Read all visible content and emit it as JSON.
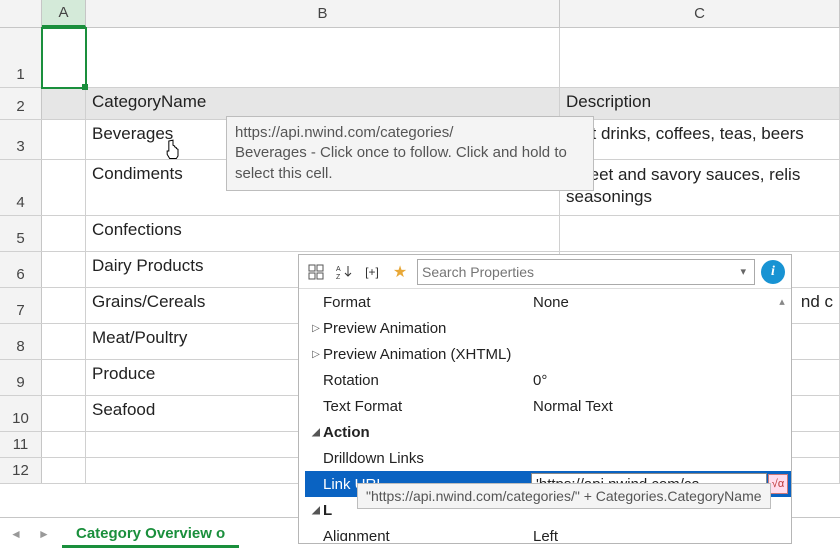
{
  "columns": {
    "A": "A",
    "B": "B",
    "C": "C"
  },
  "row_numbers": [
    "1",
    "2",
    "3",
    "4",
    "5",
    "6",
    "7",
    "8",
    "9",
    "10",
    "11",
    "12"
  ],
  "header": {
    "B": "CategoryName",
    "C": "Description"
  },
  "cells": {
    "B3": "Beverages",
    "C3": "Soft drinks, coffees, teas, beers",
    "B4": "Condiments",
    "C4": "Sweet and savory sauces, relis​ seasonings",
    "B5": "Confections",
    "C5": "",
    "B6": "Dairy Products",
    "B7": "Grains/Cereals",
    "C7": "nd c",
    "B8": "Meat/Poultry",
    "B9": "Produce",
    "B10": "Seafood"
  },
  "tooltip": {
    "url": "https://api.nwind.com/categories/",
    "rest": "Beverages - Click once to follow. Click and hold to select this cell."
  },
  "props": {
    "search_placeholder": "Search Properties",
    "rows": [
      {
        "label": "Format",
        "value": "None",
        "indent": 1
      },
      {
        "label": "Preview Animation",
        "value": "",
        "expander": "▷",
        "indent": 0
      },
      {
        "label": "Preview Animation (XHTML)",
        "value": "",
        "expander": "▷",
        "indent": 0
      },
      {
        "label": "Rotation",
        "value": "0°",
        "indent": 1
      },
      {
        "label": "Text Format",
        "value": "Normal Text",
        "indent": 1
      }
    ],
    "group_action": "Action",
    "drilldown": "Drilldown Links",
    "link_url_label": "Link URL",
    "link_url_value": "'https://api.nwind.com/ca",
    "group_layout_prefix": "L",
    "alignment_label": "Alignment",
    "alignment_value": "Left",
    "expr_tooltip": "\"https://api.nwind.com/categories/\" + Categories.CategoryName"
  },
  "sheet_tab": "Category Overview o"
}
